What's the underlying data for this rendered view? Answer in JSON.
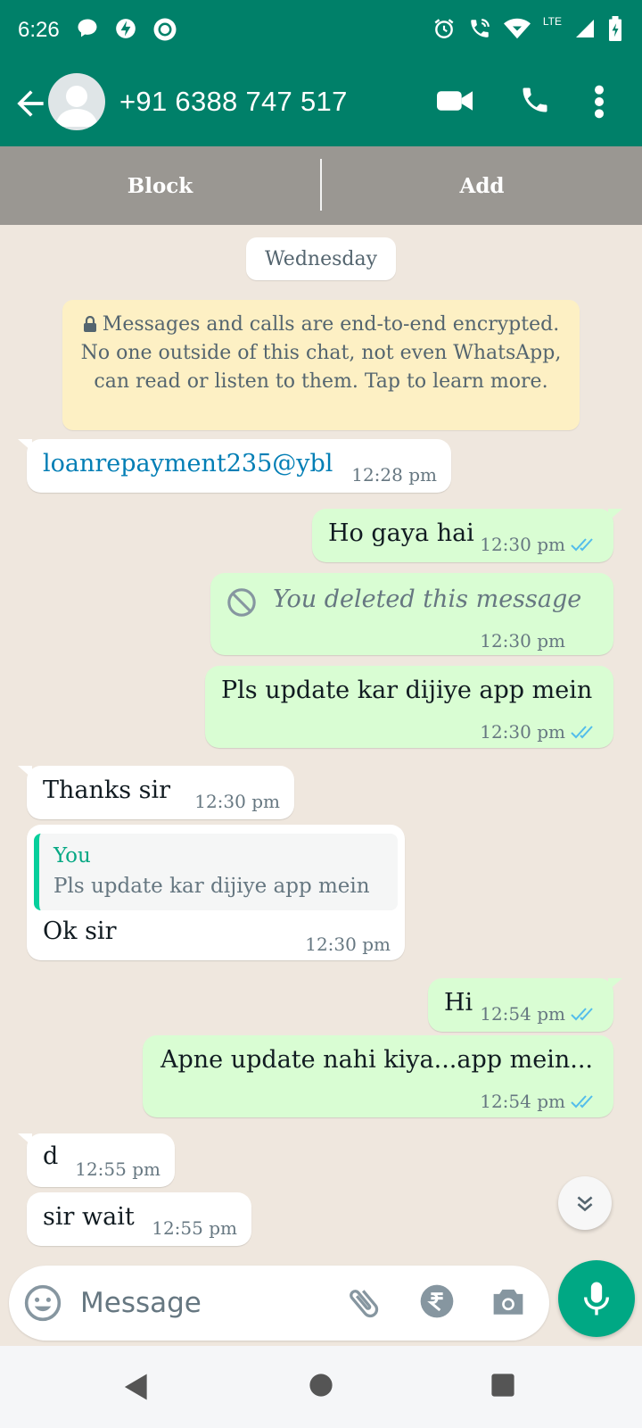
{
  "status_bar": {
    "time": "6:26",
    "network": "LTE"
  },
  "header": {
    "title": "+91 6388 747 517",
    "icons": [
      "back-arrow-icon",
      "avatar-icon",
      "video-call-icon",
      "phone-icon",
      "more-vert-icon"
    ]
  },
  "actions": {
    "block_label": "Block",
    "add_label": "Add"
  },
  "chat": {
    "date_label": "Wednesday",
    "encryption_notice": "Messages and calls are end-to-end encrypted. No one outside of this chat, not even WhatsApp, can read or listen to them. Tap to learn more.",
    "messages": [
      {
        "dir": "in",
        "text": "loanrepayment235@ybl",
        "time": "12:28 pm"
      },
      {
        "dir": "out",
        "text": "Ho gaya hai",
        "time": "12:30 pm",
        "ticks": "read"
      },
      {
        "dir": "out",
        "text": "You deleted this message",
        "time": "12:30 pm"
      },
      {
        "dir": "out",
        "text": "Pls update kar dijiye app mein",
        "time": "12:30 pm",
        "ticks": "read"
      },
      {
        "dir": "in",
        "text": "Thanks sir",
        "time": "12:30 pm"
      },
      {
        "dir": "in",
        "quote_author": "You",
        "quote_text": "Pls update kar dijiye app mein",
        "text": "Ok sir",
        "time": "12:30 pm"
      },
      {
        "dir": "out",
        "text": "Hi",
        "time": "12:54 pm",
        "ticks": "read"
      },
      {
        "dir": "out",
        "text": "Apne update nahi kiya...app mein...",
        "time": "12:54 pm",
        "ticks": "read"
      },
      {
        "dir": "in",
        "text": "d",
        "time": "12:55 pm"
      },
      {
        "dir": "in",
        "text": "sir wait",
        "time": "12:55 pm"
      }
    ]
  },
  "composer": {
    "placeholder": "Message"
  },
  "colors": {
    "header": "#008069",
    "outgoing_bubble": "#d9fdd3",
    "incoming_bubble": "#ffffff",
    "read_ticks": "#53bdeb",
    "mic_button": "#00a884"
  }
}
